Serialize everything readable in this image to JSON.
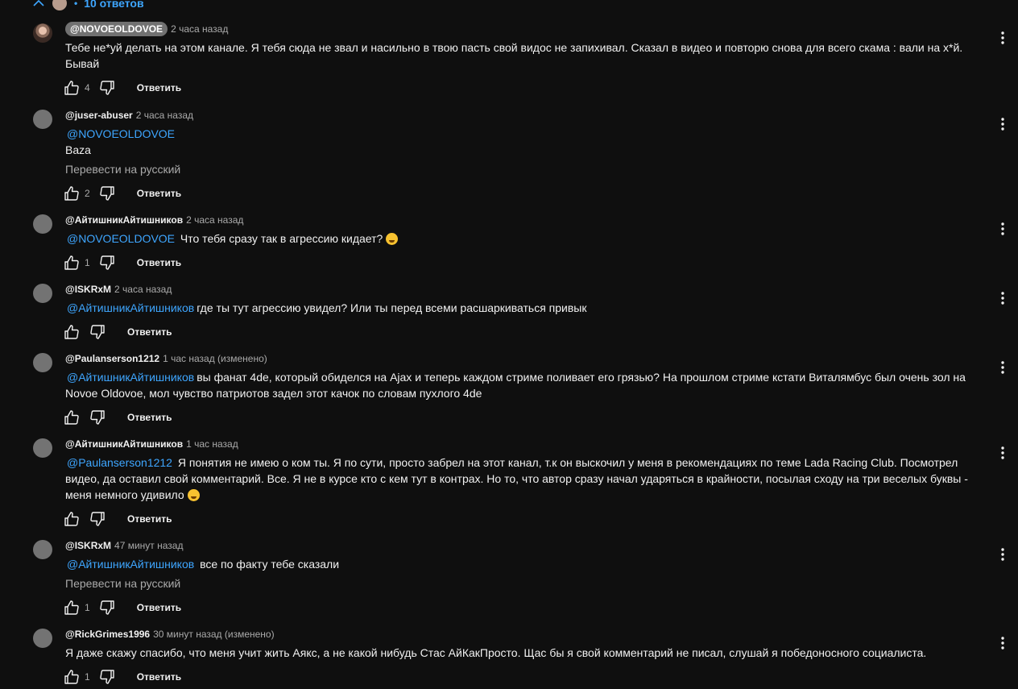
{
  "replies_toggle": {
    "label": "10 ответов",
    "separator": "•"
  },
  "comments": [
    {
      "author": "@NOVOEOLDOVOE",
      "time": "2 часа назад",
      "mention": "",
      "text": "Тебе не*уй делать на этом канале. Я тебя сюда не звал и насильно в твою пасть свой видос не запихивал. Сказал в видео и повторю снова для всего скама : вали на х*й. Бывай",
      "likes": "4",
      "reply": "Ответить"
    },
    {
      "author": "@juser-abuser",
      "time": "2 часа назад",
      "mention": "@NOVOEOLDOVOE",
      "text": "Baza",
      "translate": "Перевести на русский",
      "likes": "2",
      "reply": "Ответить"
    },
    {
      "author": "@АйтишникАйтишников",
      "time": "2 часа назад",
      "mention": "@NOVOEOLDOVOE",
      "text": "Что тебя сразу так в агрессию кидает?",
      "likes": "1",
      "reply": "Ответить"
    },
    {
      "author": "@ISKRxM",
      "time": "2 часа назад",
      "mention": "@АйтишникАйтишников",
      "text": "где ты тут агрессию увидел?  Или ты перед всеми расшаркиваться привык",
      "likes": "",
      "reply": "Ответить"
    },
    {
      "author": "@Paulanserson1212",
      "time": "1 час назад (изменено)",
      "mention": "@АйтишникАйтишников",
      "text": "вы фанат 4de, который обиделся на Ajax и теперь каждом стриме поливает его грязью? На прошлом стриме кстати Виталямбус был очень зол на Novoe Oldovoe, мол чувство патриотов задел этот качок по словам пухлого 4de",
      "likes": "",
      "reply": "Ответить"
    },
    {
      "author": "@АйтишникАйтишников",
      "time": "1 час назад",
      "mention": "@Paulanserson1212",
      "text": "Я понятия не имею о ком ты. Я по сути, просто забрел на этот канал, т.к он выскочил у меня в рекомендациях по теме Lada Racing Club. Посмотрел видео, да оставил свой комментарий. Все. Я не в курсе кто с кем тут в контрах. Но то, что автор сразу начал ударяться в крайности, посылая сходу на три веселых буквы - меня немного удивило",
      "likes": "",
      "reply": "Ответить"
    },
    {
      "author": "@ISKRxM",
      "time": "47 минут назад",
      "mention": "@АйтишникАйтишников",
      "text": "все по факту тебе сказали",
      "translate": "Перевести на русский",
      "likes": "1",
      "reply": "Ответить"
    },
    {
      "author": "@RickGrimes1996",
      "time": "30 минут назад (изменено)",
      "mention": "",
      "text": "Я даже скажу спасибо, что меня учит жить Аякс, а не какой нибудь Стас АйКакПросто. Щас бы я свой комментарий не писал, слушай я победоносного социалиста.",
      "likes": "1",
      "reply": "Ответить"
    }
  ],
  "colors": {
    "background": "#0f0f0f",
    "link": "#3ea6ff",
    "text": "#f1f1f1",
    "muted": "#aaaaaa"
  }
}
